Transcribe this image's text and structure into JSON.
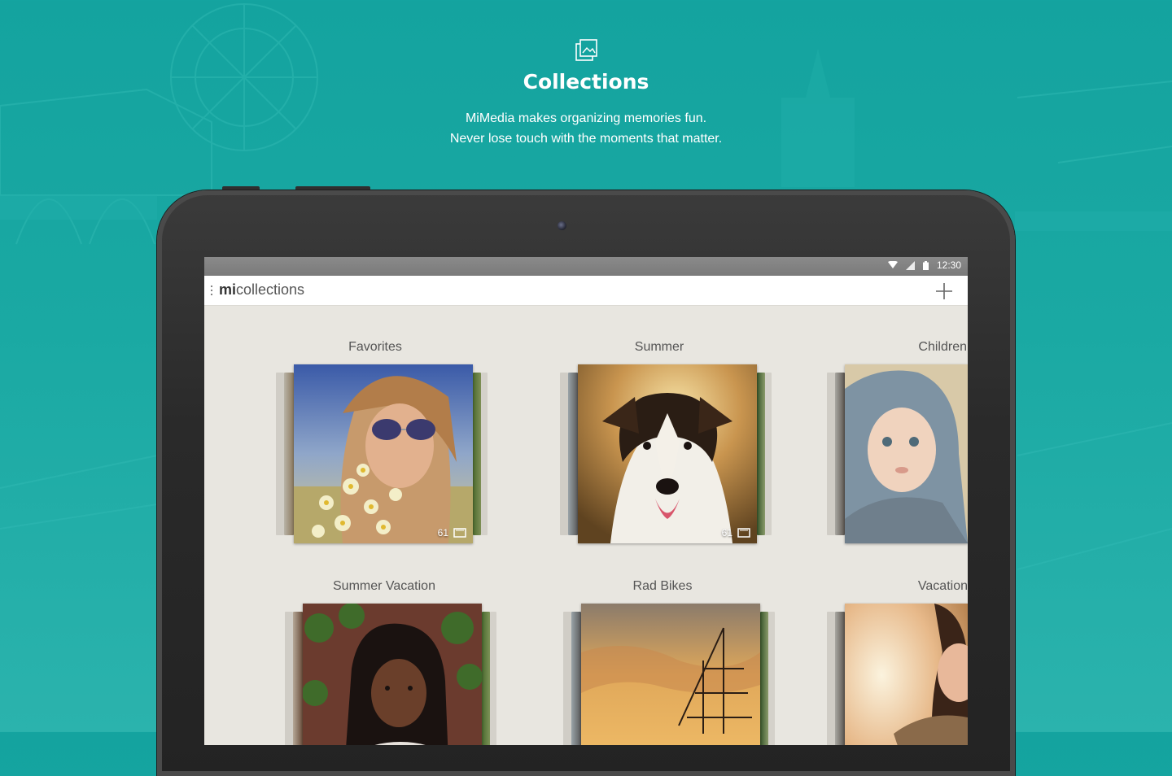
{
  "hero": {
    "title": "Collections",
    "subtitle_line1": "MiMedia makes organizing memories fun.",
    "subtitle_line2": "Never lose touch with the moments that matter."
  },
  "status_bar": {
    "time": "12:30"
  },
  "app_bar": {
    "title_bold": "mi",
    "title_rest": "collections"
  },
  "collections": [
    {
      "label": "Favorites",
      "count": "61",
      "photo": "woman-sunglasses-flowers-photo"
    },
    {
      "label": "Summer",
      "count": "61",
      "photo": "dog-sunset-photo"
    },
    {
      "label": "Children",
      "count": "",
      "photo": "baby-hood-photo"
    },
    {
      "label": "Summer Vacation",
      "count": "",
      "photo": "girl-braids-photo"
    },
    {
      "label": "Rad Bikes",
      "count": "",
      "photo": "ship-sunset-photo"
    },
    {
      "label": "Vacation",
      "count": "",
      "photo": "child-warm-light-photo"
    }
  ],
  "colors": {
    "background": "#1aa9a3",
    "screen": "#e8e6e0",
    "status_bar": "#7f7f7f"
  }
}
